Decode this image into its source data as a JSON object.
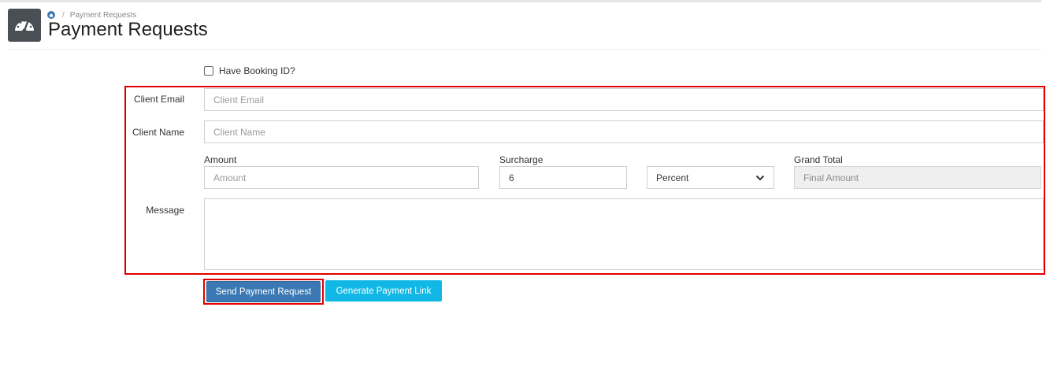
{
  "breadcrumb": {
    "home_icon": "home-icon",
    "current": "Payment Requests"
  },
  "page": {
    "title": "Payment Requests",
    "logo_icon": "dashboard-gauge-icon"
  },
  "form": {
    "have_booking_label": "Have Booking ID?",
    "have_booking_checked": false,
    "client_email": {
      "label": "Client Email",
      "placeholder": "Client Email",
      "value": ""
    },
    "client_name": {
      "label": "Client Name",
      "placeholder": "Client Name",
      "value": ""
    },
    "amount": {
      "label": "Amount",
      "placeholder": "Amount",
      "value": ""
    },
    "surcharge": {
      "label": "Surcharge",
      "value": "6"
    },
    "surcharge_type": {
      "selected": "Percent"
    },
    "grand_total": {
      "label": "Grand Total",
      "placeholder": "Final Amount"
    },
    "message": {
      "label": "Message",
      "value": ""
    }
  },
  "actions": {
    "send_label": "Send Payment Request",
    "generate_label": "Generate Payment Link"
  },
  "colors": {
    "highlight": "#e00000",
    "primary_button": "#3a79b3",
    "info_button": "#11b8e6",
    "logo_bg": "#4a4f55"
  }
}
